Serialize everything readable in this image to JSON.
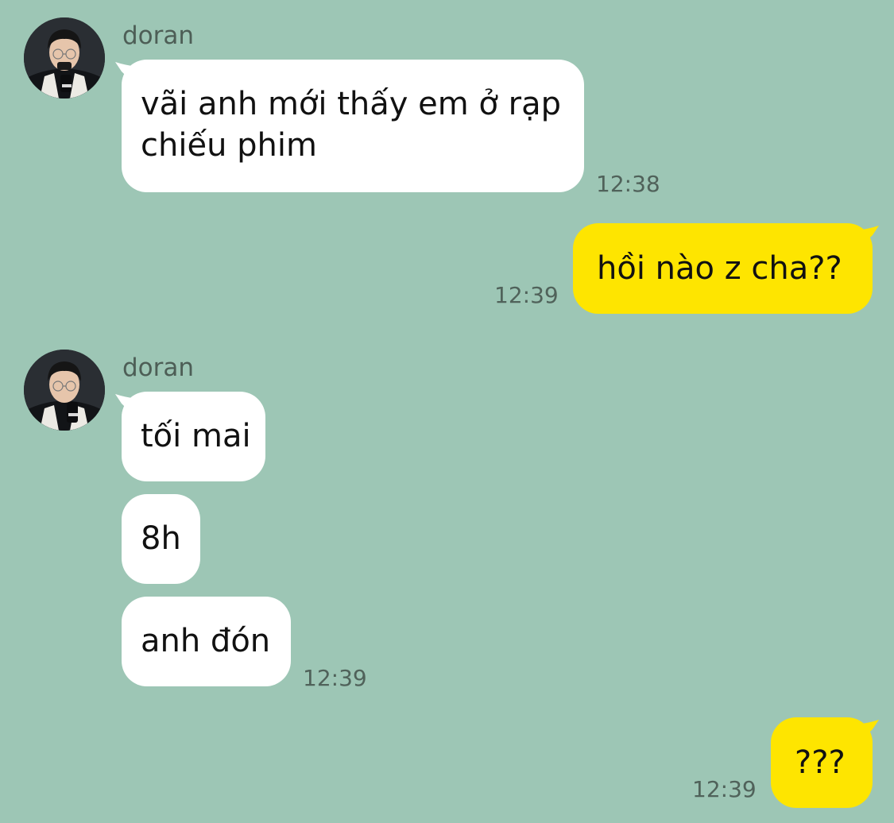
{
  "chat": {
    "colors": {
      "background": "#9dc6b5",
      "incoming_bubble": "#ffffff",
      "outgoing_bubble": "#fee500"
    },
    "groups": [
      {
        "sender": "doran",
        "avatar_icon": "profile-photo",
        "messages": [
          {
            "line1": "vãi anh mới thấy em ở rạp",
            "line2": "chiếu phim"
          }
        ],
        "time": "12:38"
      },
      {
        "sender": "me",
        "messages": [
          {
            "text": "hồi nào z cha??"
          }
        ],
        "time": "12:39"
      },
      {
        "sender": "doran",
        "avatar_icon": "profile-photo",
        "messages": [
          {
            "text": "tối mai"
          },
          {
            "text": "8h"
          },
          {
            "text": "anh đón"
          }
        ],
        "time": "12:39"
      },
      {
        "sender": "me",
        "messages": [
          {
            "text": "???"
          }
        ],
        "time": "12:39"
      }
    ]
  }
}
